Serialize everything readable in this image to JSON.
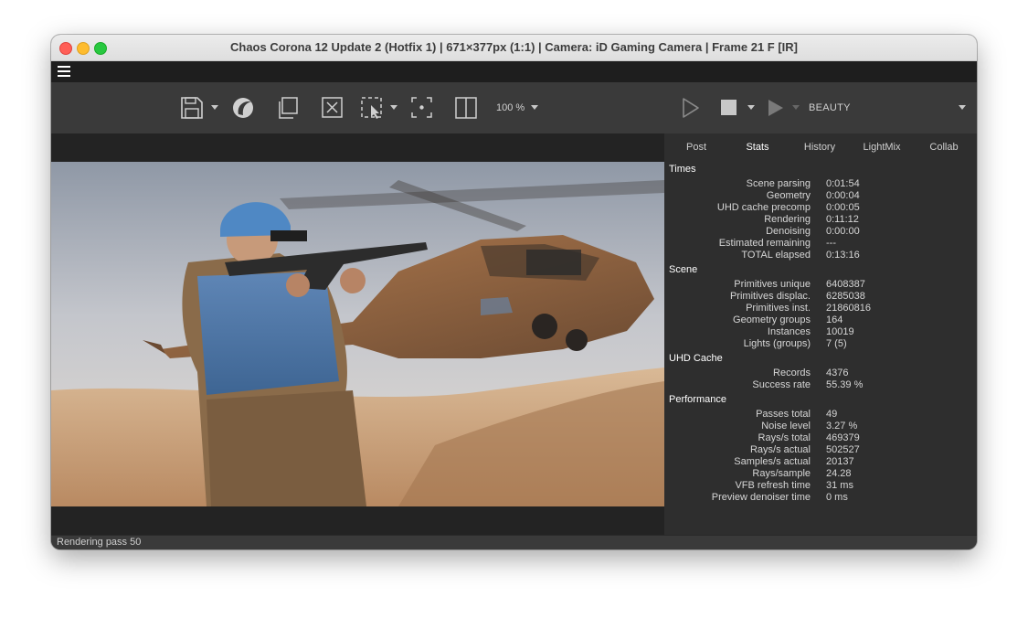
{
  "window": {
    "title": "Chaos Corona 12 Update 2 (Hotfix 1) | 671×377px (1:1) | Camera: iD Gaming Camera | Frame 21 F [IR]"
  },
  "toolbar": {
    "zoom_label": "100 %",
    "render_element": "BEAUTY",
    "icons": [
      "save-icon",
      "corona-logo-icon",
      "copy-icon",
      "clear-icon",
      "region-select-icon",
      "focus-point-icon",
      "compare-split-icon",
      "start-render-icon",
      "stop-icon",
      "resume-icon"
    ]
  },
  "tabs": [
    "Post",
    "Stats",
    "History",
    "LightMix",
    "Collab"
  ],
  "active_tab": "Stats",
  "stats": {
    "times": {
      "title": "Times",
      "rows": [
        {
          "label": "Scene parsing",
          "value": "0:01:54"
        },
        {
          "label": "Geometry",
          "value": "0:00:04"
        },
        {
          "label": "UHD cache precomp",
          "value": "0:00:05"
        },
        {
          "label": "Rendering",
          "value": "0:11:12"
        },
        {
          "label": "Denoising",
          "value": "0:00:00"
        },
        {
          "label": "Estimated remaining",
          "value": "---"
        },
        {
          "label": "TOTAL elapsed",
          "value": "0:13:16"
        }
      ]
    },
    "scene": {
      "title": "Scene",
      "rows": [
        {
          "label": "Primitives unique",
          "value": "6408387"
        },
        {
          "label": "Primitives displac.",
          "value": "6285038"
        },
        {
          "label": "Primitives inst.",
          "value": "21860816"
        },
        {
          "label": "Geometry groups",
          "value": "164"
        },
        {
          "label": "Instances",
          "value": "10019"
        },
        {
          "label": "Lights (groups)",
          "value": "7 (5)"
        }
      ]
    },
    "uhd_cache": {
      "title": "UHD Cache",
      "rows": [
        {
          "label": "Records",
          "value": "4376"
        },
        {
          "label": "Success rate",
          "value": "55.39 %"
        }
      ]
    },
    "performance": {
      "title": "Performance",
      "rows": [
        {
          "label": "Passes total",
          "value": "49"
        },
        {
          "label": "Noise level",
          "value": "3.27 %"
        },
        {
          "label": "Rays/s total",
          "value": "469379"
        },
        {
          "label": "Rays/s actual",
          "value": "502527"
        },
        {
          "label": "Samples/s actual",
          "value": "20137"
        },
        {
          "label": "Rays/sample",
          "value": "24.28"
        },
        {
          "label": "VFB refresh time",
          "value": "31 ms"
        },
        {
          "label": "Preview denoiser time",
          "value": "0 ms"
        }
      ]
    }
  },
  "status": {
    "text": "Rendering pass 50"
  }
}
